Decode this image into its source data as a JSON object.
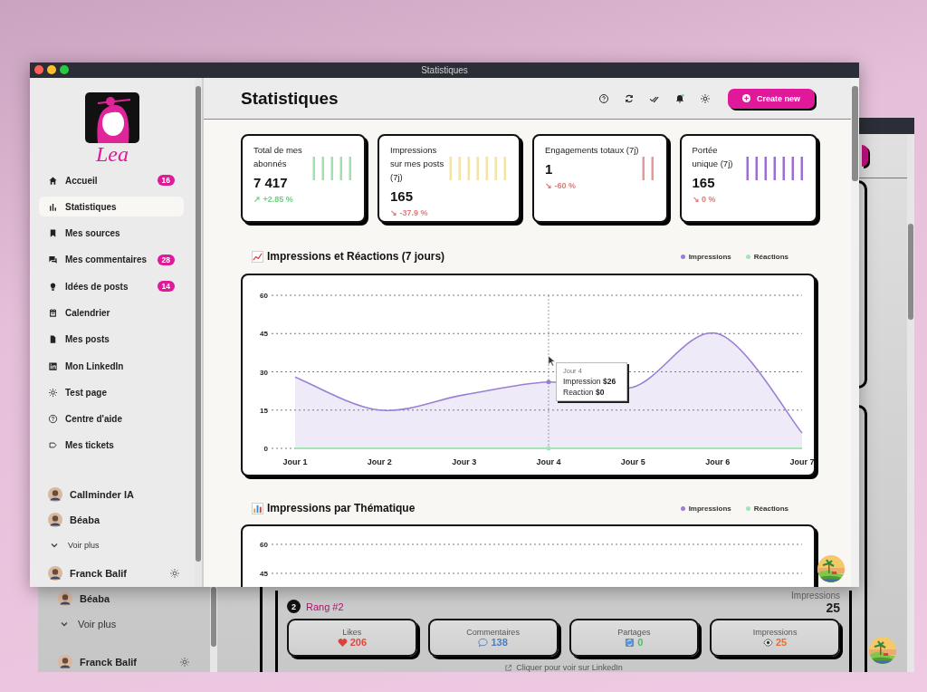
{
  "window": {
    "title": "Statistiques"
  },
  "sidebar": {
    "logo_text": "Lea",
    "items": [
      {
        "label": "Accueil",
        "badge": "16",
        "selected": false
      },
      {
        "label": "Statistiques",
        "selected": true
      },
      {
        "label": "Mes sources",
        "selected": false
      },
      {
        "label": "Mes commentaires",
        "badge": "28",
        "selected": false
      },
      {
        "label": "Idées de posts",
        "badge": "14",
        "selected": false
      },
      {
        "label": "Calendrier",
        "selected": false
      },
      {
        "label": "Mes posts",
        "selected": false
      },
      {
        "label": "Mon LinkedIn",
        "selected": false
      },
      {
        "label": "Test page",
        "selected": false
      },
      {
        "label": "Centre d'aide",
        "selected": false
      },
      {
        "label": "Mes tickets",
        "selected": false
      }
    ],
    "accounts": [
      {
        "name": "Callminder IA"
      },
      {
        "name": "Béaba"
      }
    ],
    "more": "Voir plus",
    "user": "Franck Balif"
  },
  "header": {
    "title": "Statistiques",
    "button": "Create new"
  },
  "stats": [
    {
      "label": "Total de mes abonnés",
      "value": "7 417",
      "change": {
        "arrow": "↗",
        "text": "+2.85 %",
        "color": "#6fcf86"
      },
      "color": "#9fe0ae"
    },
    {
      "label": "Impressions sur mes posts (7j)",
      "value": "165",
      "change": {
        "arrow": "↘",
        "text": "-37.9 %",
        "color": "#e07b7b"
      },
      "color": "#f3e3a4"
    },
    {
      "label": "Engagements totaux (7j)",
      "value": "1",
      "change": {
        "arrow": "↘",
        "text": "-60 %",
        "color": "#e07b7b"
      },
      "color": "#e39a9a"
    },
    {
      "label": "Portée unique (7j)",
      "value": "165",
      "change": {
        "arrow": "↘",
        "text": "0 %",
        "color": "#e07b7b"
      },
      "color": "#9b6fd6"
    }
  ],
  "charts": [
    {
      "title": "Impressions et Réactions (7 jours)",
      "chart_data": {
        "type": "area",
        "categories": [
          "Jour 1",
          "Jour 2",
          "Jour 3",
          "Jour 4",
          "Jour 5",
          "Jour 6",
          "Jour 7"
        ],
        "ylim": [
          0,
          60
        ],
        "yticks": [
          0,
          15,
          30,
          45,
          60
        ],
        "grid": true,
        "series": [
          {
            "name": "Impressions",
            "color": "#9b7fd4",
            "values": [
              28,
              15,
              21,
              26,
              24,
              45,
              6
            ]
          },
          {
            "name": "Réactions",
            "type": "line",
            "color": "#a3e4b8",
            "values": [
              0,
              0,
              0,
              0,
              0,
              0,
              0
            ]
          }
        ],
        "ref_lines": [
          {
            "axis": "x",
            "value": "Jour 4"
          }
        ]
      },
      "tooltip": {
        "title": "Jour 4",
        "lines": [
          "Impression **$26**",
          "Reaction **$0**"
        ]
      }
    },
    {
      "title": "Impressions par Thématique",
      "chart_data": {
        "type": "bar",
        "ylim": [
          45,
          60
        ],
        "yticks": [
          45,
          60
        ],
        "grid": true,
        "series": [
          {
            "name": "Impressions",
            "color": "#9b7fd4"
          },
          {
            "name": "Réactions",
            "color": "#a3e4b8"
          }
        ]
      }
    }
  ],
  "background_window": {
    "accounts": [
      {
        "name": "Béaba"
      }
    ],
    "more": "Voir plus",
    "user": "Franck Balif",
    "rank": {
      "number": "2",
      "label": "Rang #2",
      "metric_label": "Impressions",
      "metric_value": "25"
    },
    "metrics": [
      {
        "label": "Likes",
        "value": "206",
        "color": "#e0483c"
      },
      {
        "label": "Commentaires",
        "value": "138",
        "color": "#4a7fc0"
      },
      {
        "label": "Partages",
        "value": "0",
        "color": "#4bbf5c"
      },
      {
        "label": "Impressions",
        "value": "25",
        "color": "#e0703a"
      }
    ],
    "link": "Cliquer pour voir sur LinkedIn"
  }
}
